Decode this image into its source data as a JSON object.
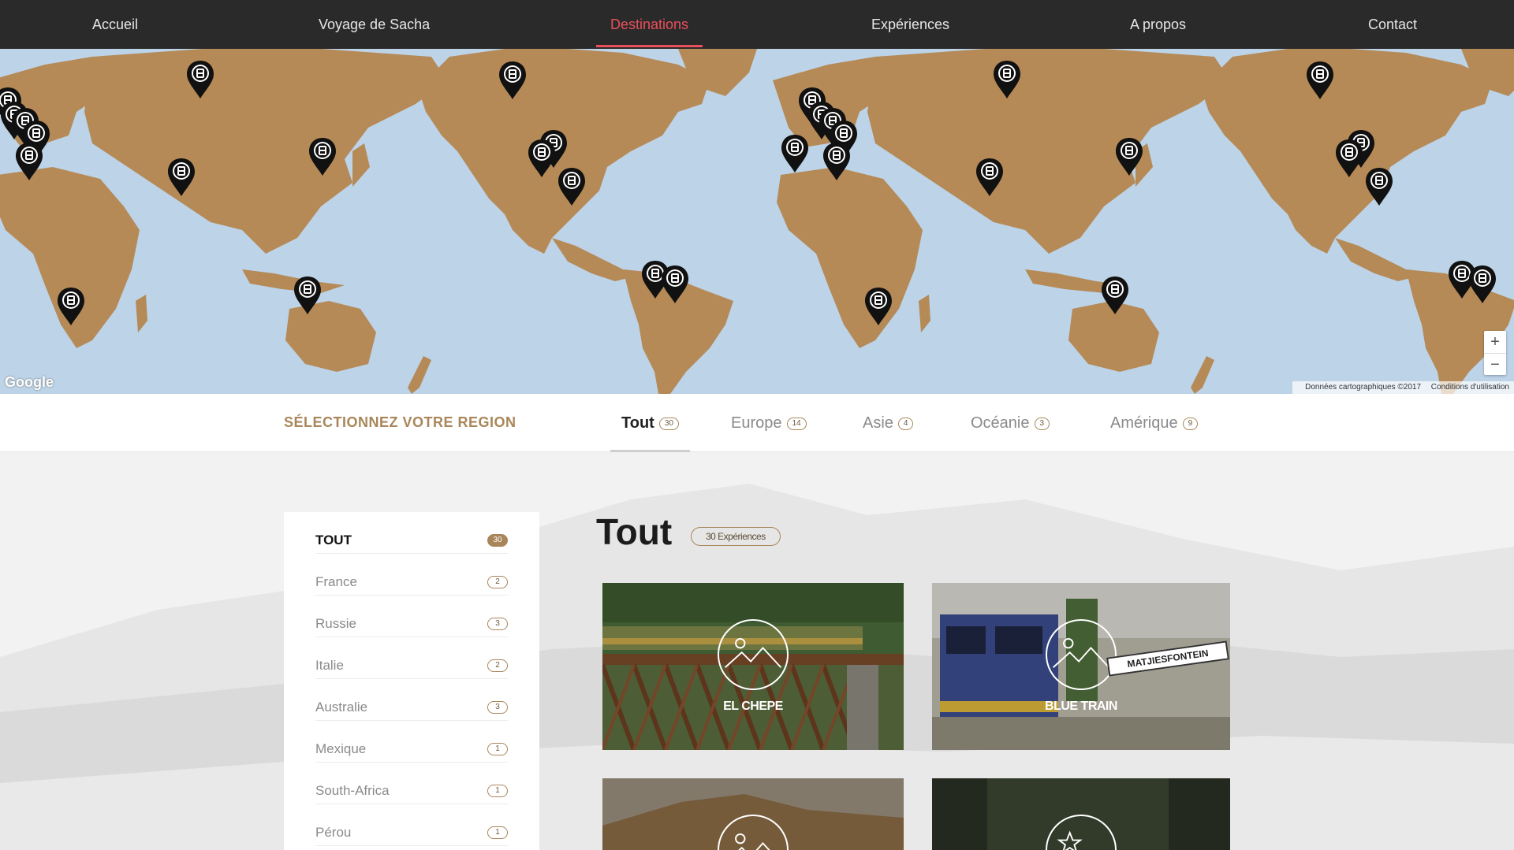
{
  "nav": {
    "items": [
      {
        "label": "Accueil"
      },
      {
        "label": "Voyage de Sacha"
      },
      {
        "label": "Destinations"
      },
      {
        "label": "Expériences"
      },
      {
        "label": "A propos"
      },
      {
        "label": "Contact"
      }
    ],
    "active": "Destinations"
  },
  "map": {
    "logo": "Google",
    "data_credit": "Données cartographiques ©2017",
    "terms": "Conditions d'utilisation",
    "zoom_in": "+",
    "zoom_out": "−",
    "marker_icon": "train-marker-icon",
    "land_color": "#b58a57",
    "water_color": "#bcd3e8"
  },
  "region_bar": {
    "title": "SÉLECTIONNEZ VOTRE REGION",
    "tabs": [
      {
        "label": "Tout",
        "count": "30"
      },
      {
        "label": "Europe",
        "count": "14"
      },
      {
        "label": "Asie",
        "count": "4"
      },
      {
        "label": "Océanie",
        "count": "3"
      },
      {
        "label": "Amérique",
        "count": "9"
      }
    ],
    "active": "Tout"
  },
  "sidebar": {
    "items": [
      {
        "label": "TOUT",
        "count": "30"
      },
      {
        "label": "France",
        "count": "2"
      },
      {
        "label": "Russie",
        "count": "3"
      },
      {
        "label": "Italie",
        "count": "2"
      },
      {
        "label": "Australie",
        "count": "3"
      },
      {
        "label": "Mexique",
        "count": "1"
      },
      {
        "label": "South-Africa",
        "count": "1"
      },
      {
        "label": "Pérou",
        "count": "1"
      }
    ]
  },
  "content": {
    "title": "Tout",
    "badge": "30 Expériences",
    "cards": [
      {
        "label": "EL CHEPE",
        "icon": "mountain-icon"
      },
      {
        "label": "BLUE TRAIN",
        "icon": "mountain-icon",
        "sign": "MATJIESFONTEIN"
      },
      {
        "label": "",
        "icon": "mountain-icon"
      },
      {
        "label": "",
        "icon": "star-icon"
      }
    ]
  },
  "colors": {
    "accent": "#e8505b",
    "brand_gold": "#a9865a",
    "nav_bg": "#2a2a2a"
  }
}
